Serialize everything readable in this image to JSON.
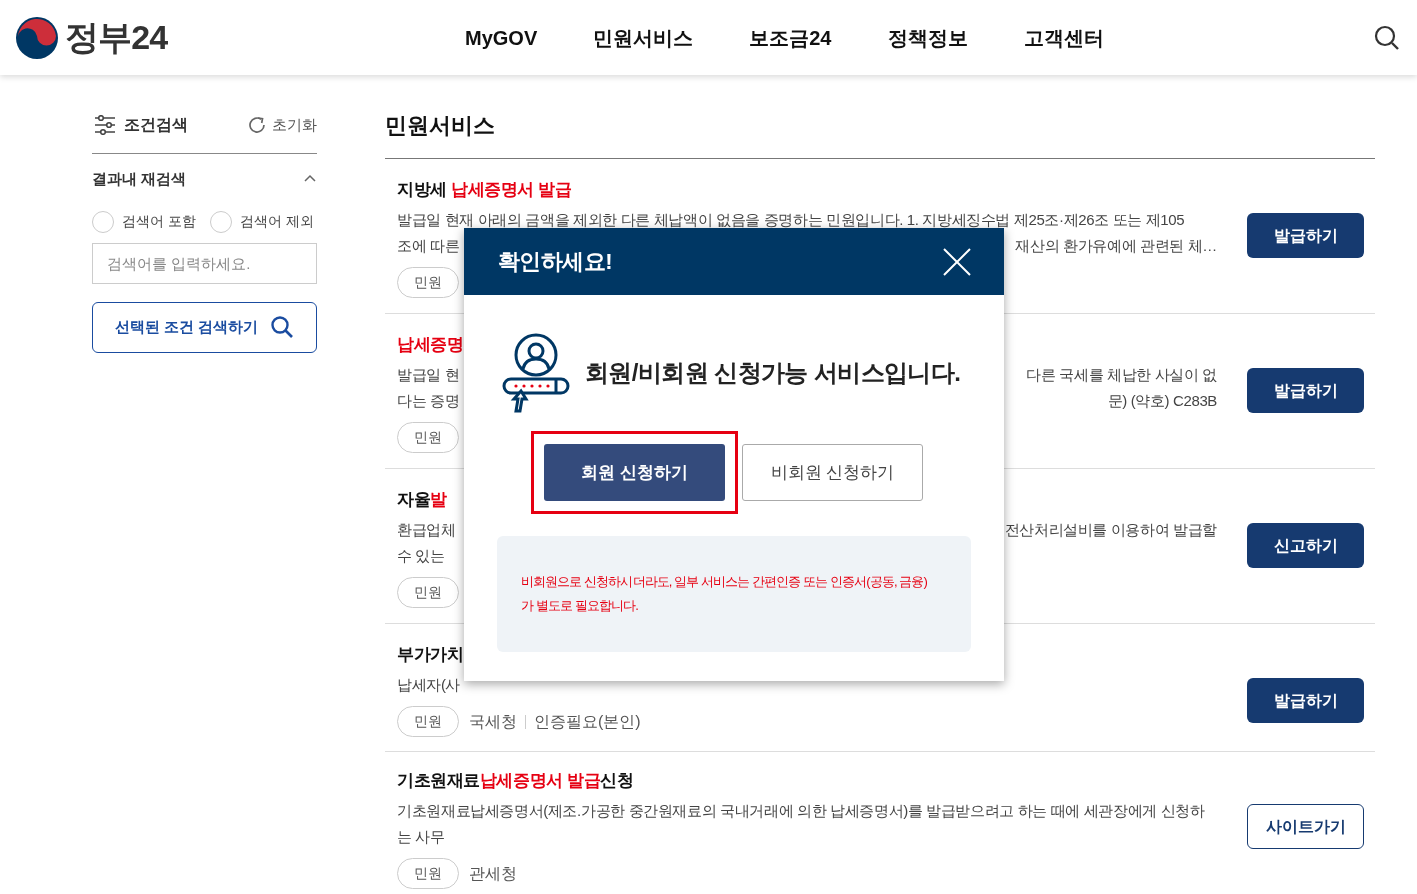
{
  "header": {
    "logo": "정부24",
    "nav": [
      {
        "label": "MyGOV"
      },
      {
        "label": "민원서비스"
      },
      {
        "label": "보조금24"
      },
      {
        "label": "정책정보"
      },
      {
        "label": "고객센터"
      }
    ]
  },
  "sidebar": {
    "title": "조건검색",
    "reset": "초기화",
    "section": {
      "title": "결과내 재검색",
      "expanded": true
    },
    "radios": [
      {
        "label": "검색어 포함",
        "selected": false
      },
      {
        "label": "검색어 제외",
        "selected": false
      }
    ],
    "search": {
      "placeholder": "검색어를 입력하세요."
    },
    "submit": "선택된 조건 검색하기"
  },
  "main": {
    "heading": "민원서비스",
    "items": [
      {
        "title": [
          {
            "text": "지방세 ",
            "highlight": false
          },
          {
            "text": "납세증명서 발급",
            "highlight": true
          }
        ],
        "lines": [
          {
            "left": "발급일 현재 아래의 금액을 제외한 다른 체납액이 없음을 증명하는 민원입니다. 1. 지방세징수법 제25조·제26조 또는 제105"
          },
          {
            "left": "조에 따른",
            "right": "재산의 환가유예에 관련된 체…"
          }
        ],
        "tag": "민원",
        "button": {
          "label": "발급하기",
          "kind": "filled"
        }
      },
      {
        "title": [
          {
            "text": "납세증명",
            "highlight": true
          }
        ],
        "lines": [
          {
            "left": "발급일 현",
            "right": "다른 국세를 체납한 사실이 없"
          },
          {
            "left": "다는 증명",
            "right": "문) (약호) C283B"
          }
        ],
        "tag": "민원",
        "button": {
          "label": "발급하기",
          "kind": "filled"
        }
      },
      {
        "title": [
          {
            "text": "자율",
            "highlight": false
          },
          {
            "text": "발",
            "highlight": true
          }
        ],
        "lines": [
          {
            "left": "환급업체",
            "right": "전산처리설비를 이용하여 발급할"
          },
          {
            "left": "수 있는"
          }
        ],
        "tag": "민원",
        "button": {
          "label": "신고하기",
          "kind": "filled"
        }
      },
      {
        "title": [
          {
            "text": "부가가치",
            "highlight": false
          }
        ],
        "lines": [
          {
            "left": "납세자(사"
          }
        ],
        "tag": "민원",
        "meta": [
          "국세청",
          "인증필요(본인)"
        ],
        "button": {
          "label": "발급하기",
          "kind": "filled"
        }
      },
      {
        "title": [
          {
            "text": "기초원재료",
            "highlight": false
          },
          {
            "text": "납세증명서 발급",
            "highlight": true
          },
          {
            "text": "신청",
            "highlight": false
          }
        ],
        "paragraph": "기초원재료납세증명서(제조.가공한 중간원재료의 국내거래에 의한 납세증명서)를 발급받으려고 하는 때에 세관장에게 신청하는 사무",
        "tag": "민원",
        "meta": [
          "관세청"
        ],
        "button": {
          "label": "사이트가기",
          "kind": "outline"
        }
      }
    ]
  },
  "modal": {
    "title": "확인하세요!",
    "message": "회원/비회원 신청가능 서비스입니다.",
    "buttons": [
      {
        "label": "회원 신청하기",
        "kind": "primary",
        "highlighted": true
      },
      {
        "label": "비회원 신청하기",
        "kind": "secondary",
        "highlighted": false
      }
    ],
    "notice": [
      "비회원으로 신청하시더라도, 일부 서비스는 간편인증 또는 인증서(공동, 금융)",
      "가 별도로 필요합니다."
    ]
  }
}
